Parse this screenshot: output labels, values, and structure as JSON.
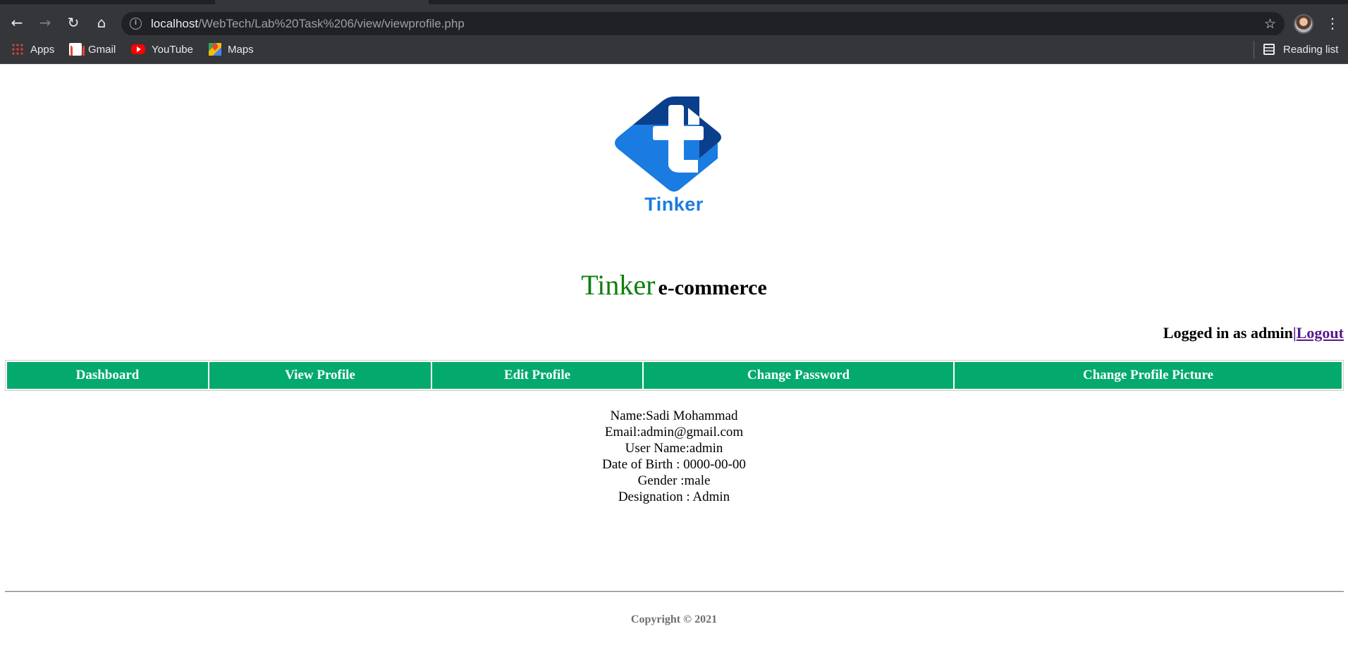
{
  "browser": {
    "url_host": "localhost",
    "url_path": "/WebTech/Lab%20Task%206/view/viewprofile.php",
    "bookmarks": [
      {
        "label": "Apps",
        "icon": "apps-icon"
      },
      {
        "label": "Gmail",
        "icon": "gmail-icon"
      },
      {
        "label": "YouTube",
        "icon": "youtube-icon"
      },
      {
        "label": "Maps",
        "icon": "maps-icon"
      }
    ],
    "reading_list_label": "Reading list"
  },
  "header": {
    "logo_text": "Tinker",
    "brand_primary": "Tinker",
    "brand_secondary": "e-commerce",
    "logged_in_text": "Logged in as admin",
    "separator": "|",
    "logout_label": "Logout"
  },
  "nav": {
    "items": [
      {
        "label": "Dashboard"
      },
      {
        "label": "View Profile"
      },
      {
        "label": "Edit Profile"
      },
      {
        "label": "Change Password"
      },
      {
        "label": "Change Profile Picture"
      }
    ]
  },
  "profile": {
    "name": "Name:Sadi Mohammad",
    "email": "Email:admin@gmail.com",
    "username": "User Name:admin",
    "dob": "Date of Birth : 0000-00-00",
    "gender": "Gender :male",
    "designation": "Designation : Admin"
  },
  "footer": {
    "copyright": "Copyright © 2021"
  },
  "colors": {
    "nav_bg": "#04aa6d",
    "brand_green": "#0e7f0e",
    "logo_blue": "#1a7be0",
    "logo_dark": "#0a3f8c",
    "chrome_bg": "#35363a"
  }
}
